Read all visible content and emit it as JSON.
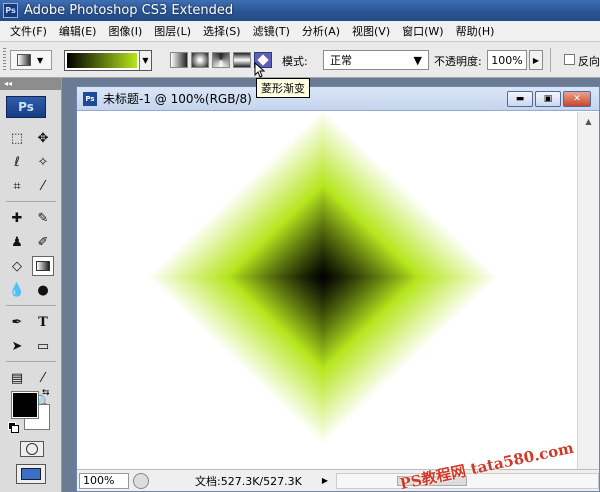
{
  "app": {
    "logo": "Ps",
    "title": "Adobe Photoshop CS3 Extended"
  },
  "menu": [
    "文件(F)",
    "编辑(E)",
    "图像(I)",
    "图层(L)",
    "选择(S)",
    "滤镜(T)",
    "分析(A)",
    "视图(V)",
    "窗口(W)",
    "帮助(H)"
  ],
  "options": {
    "mode_label": "模式:",
    "mode_value": "正常",
    "opacity_label": "不透明度:",
    "opacity_value": "100%",
    "reverse_label": "反向",
    "tooltip": "菱形渐变",
    "gradient_colors": [
      "#000000",
      "#b5e61d"
    ],
    "gradient_types": [
      "linear",
      "radial",
      "angle",
      "reflected",
      "diamond"
    ],
    "selected_gradient_type": "diamond"
  },
  "toolbox": {
    "logo": "Ps",
    "foreground_color": "#000000",
    "background_color": "#ffffff",
    "active_tool": "gradient-tool"
  },
  "document": {
    "title": "未标题-1 @ 100%(RGB/8)",
    "zoom": "100%",
    "doc_size": "文档:527.3K/527.3K",
    "gradient_center_color": "#000000",
    "gradient_mid_color": "#b5e61d",
    "gradient_outer_color": "#ffffff"
  },
  "watermark": "PS教程网 tata580.com"
}
